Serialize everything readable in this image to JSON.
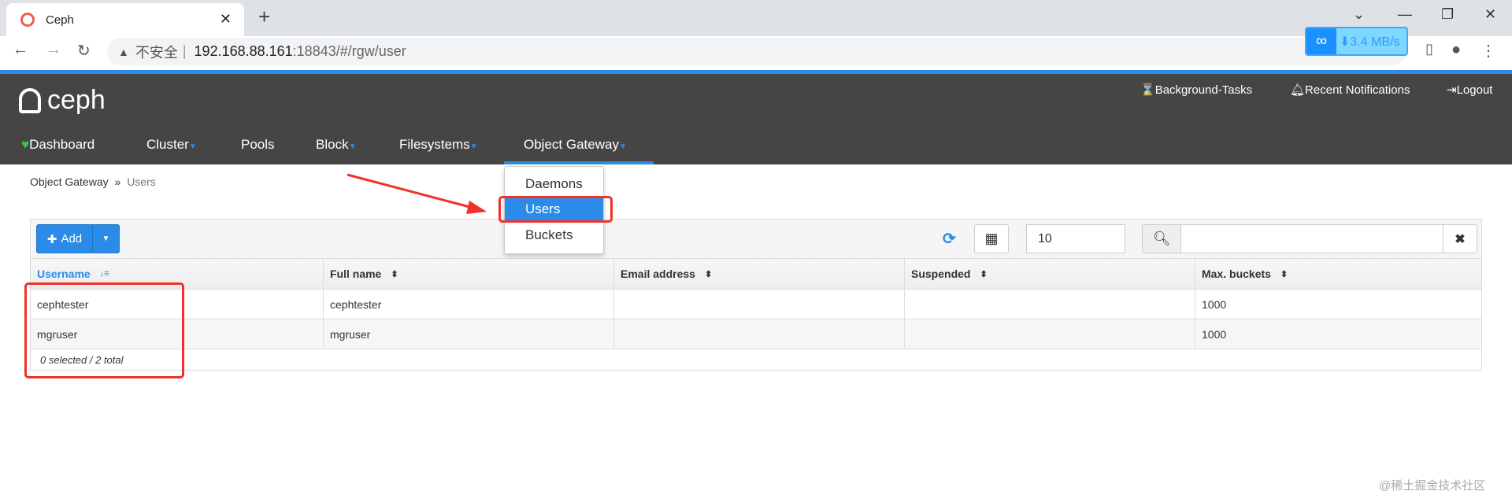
{
  "browser": {
    "tab_title": "Ceph",
    "url_warning": "不安全",
    "url_host": "192.168.88.161",
    "url_path": ":18843/#/rgw/user",
    "netdisk_speed": "⬇3.4 MB/s"
  },
  "header": {
    "brand": "ceph",
    "background_tasks": "Background-Tasks",
    "notifications": "Recent Notifications",
    "logout": "Logout"
  },
  "nav": [
    {
      "label": "Dashboard"
    },
    {
      "label": "Cluster"
    },
    {
      "label": "Pools"
    },
    {
      "label": "Block"
    },
    {
      "label": "Filesystems"
    },
    {
      "label": "Object Gateway"
    }
  ],
  "dropdown": [
    "Daemons",
    "Users",
    "Buckets"
  ],
  "breadcrumb": {
    "parent": "Object Gateway",
    "sep": "»",
    "current": "Users"
  },
  "toolbar": {
    "add_label": "Add",
    "page_size": "10",
    "search_value": ""
  },
  "table": {
    "columns": [
      "Username",
      "Full name",
      "Email address",
      "Suspended",
      "Max. buckets"
    ],
    "rows": [
      [
        "cephtester",
        "cephtester",
        "",
        "",
        "1000"
      ],
      [
        "mgruser",
        "mgruser",
        "",
        "",
        "1000"
      ]
    ],
    "footer": "0 selected / 2 total"
  },
  "colors": {
    "accent": "#2b8be8",
    "header_bg": "#474544",
    "annotation": "#f2312a"
  },
  "watermark": "@稀土掘金技术社区"
}
